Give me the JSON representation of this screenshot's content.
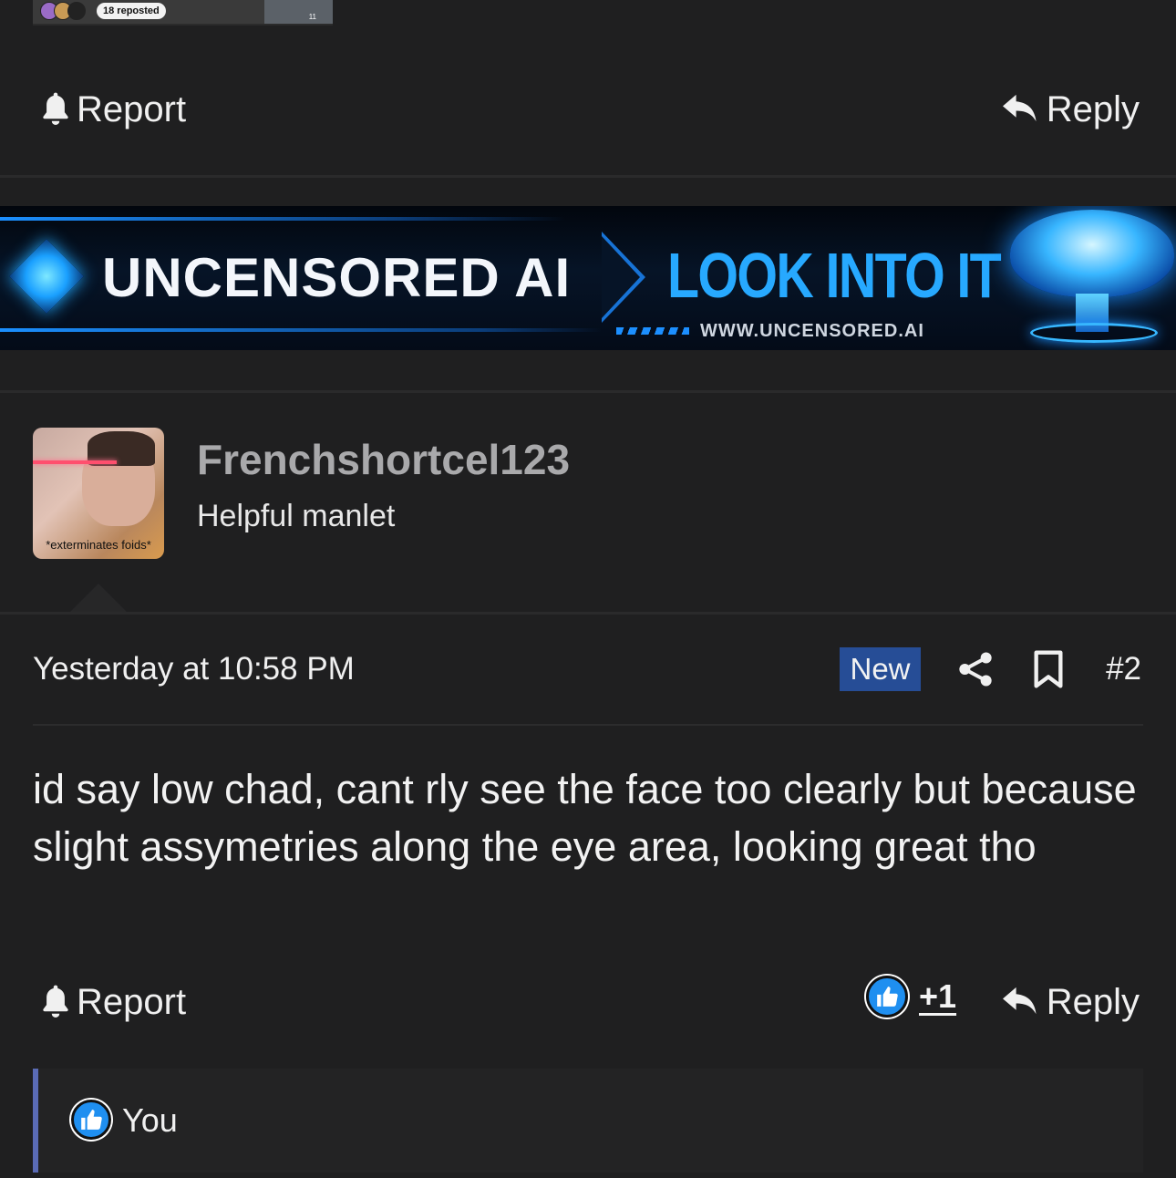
{
  "top_thumbnail": {
    "reposted_label": "18 reposted",
    "bookmark_count": "11"
  },
  "post1_actions": {
    "report_label": "Report",
    "reply_label": "Reply"
  },
  "ad_banner": {
    "headline": "UNCENSORED AI",
    "cta": "LOOK INTO IT",
    "url": "WWW.UNCENSORED.AI"
  },
  "post2": {
    "user": {
      "username": "Frenchshortcel123",
      "title": "Helpful manlet",
      "avatar_caption": "*exterminates foids*"
    },
    "meta": {
      "timestamp": "Yesterday at 10:58 PM",
      "new_badge": "New",
      "post_number": "#2"
    },
    "body_text": "id say low chad, cant rly see the face too clearly but because slight assymetries along the eye area, looking great tho",
    "actions": {
      "report_label": "Report",
      "reaction_count": "+1",
      "reply_label": "Reply"
    },
    "reactions": {
      "reactor_name": "You"
    }
  },
  "colors": {
    "background": "#1f1f20",
    "new_badge": "#264d96",
    "like_blue": "#1f8ff0",
    "reactions_border": "#5a6bb5"
  }
}
